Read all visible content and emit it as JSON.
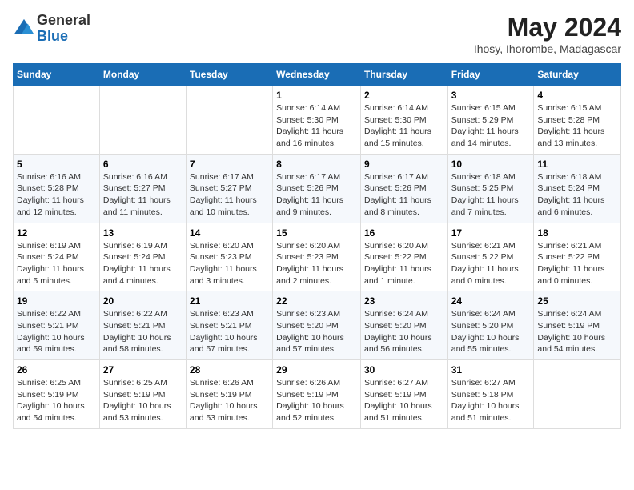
{
  "logo": {
    "general": "General",
    "blue": "Blue"
  },
  "title": "May 2024",
  "subtitle": "Ihosy, Ihorombe, Madagascar",
  "weekdays": [
    "Sunday",
    "Monday",
    "Tuesday",
    "Wednesday",
    "Thursday",
    "Friday",
    "Saturday"
  ],
  "weeks": [
    [
      {
        "day": "",
        "info": ""
      },
      {
        "day": "",
        "info": ""
      },
      {
        "day": "",
        "info": ""
      },
      {
        "day": "1",
        "info": "Sunrise: 6:14 AM\nSunset: 5:30 PM\nDaylight: 11 hours and 16 minutes."
      },
      {
        "day": "2",
        "info": "Sunrise: 6:14 AM\nSunset: 5:30 PM\nDaylight: 11 hours and 15 minutes."
      },
      {
        "day": "3",
        "info": "Sunrise: 6:15 AM\nSunset: 5:29 PM\nDaylight: 11 hours and 14 minutes."
      },
      {
        "day": "4",
        "info": "Sunrise: 6:15 AM\nSunset: 5:28 PM\nDaylight: 11 hours and 13 minutes."
      }
    ],
    [
      {
        "day": "5",
        "info": "Sunrise: 6:16 AM\nSunset: 5:28 PM\nDaylight: 11 hours and 12 minutes."
      },
      {
        "day": "6",
        "info": "Sunrise: 6:16 AM\nSunset: 5:27 PM\nDaylight: 11 hours and 11 minutes."
      },
      {
        "day": "7",
        "info": "Sunrise: 6:17 AM\nSunset: 5:27 PM\nDaylight: 11 hours and 10 minutes."
      },
      {
        "day": "8",
        "info": "Sunrise: 6:17 AM\nSunset: 5:26 PM\nDaylight: 11 hours and 9 minutes."
      },
      {
        "day": "9",
        "info": "Sunrise: 6:17 AM\nSunset: 5:26 PM\nDaylight: 11 hours and 8 minutes."
      },
      {
        "day": "10",
        "info": "Sunrise: 6:18 AM\nSunset: 5:25 PM\nDaylight: 11 hours and 7 minutes."
      },
      {
        "day": "11",
        "info": "Sunrise: 6:18 AM\nSunset: 5:24 PM\nDaylight: 11 hours and 6 minutes."
      }
    ],
    [
      {
        "day": "12",
        "info": "Sunrise: 6:19 AM\nSunset: 5:24 PM\nDaylight: 11 hours and 5 minutes."
      },
      {
        "day": "13",
        "info": "Sunrise: 6:19 AM\nSunset: 5:24 PM\nDaylight: 11 hours and 4 minutes."
      },
      {
        "day": "14",
        "info": "Sunrise: 6:20 AM\nSunset: 5:23 PM\nDaylight: 11 hours and 3 minutes."
      },
      {
        "day": "15",
        "info": "Sunrise: 6:20 AM\nSunset: 5:23 PM\nDaylight: 11 hours and 2 minutes."
      },
      {
        "day": "16",
        "info": "Sunrise: 6:20 AM\nSunset: 5:22 PM\nDaylight: 11 hours and 1 minute."
      },
      {
        "day": "17",
        "info": "Sunrise: 6:21 AM\nSunset: 5:22 PM\nDaylight: 11 hours and 0 minutes."
      },
      {
        "day": "18",
        "info": "Sunrise: 6:21 AM\nSunset: 5:22 PM\nDaylight: 11 hours and 0 minutes."
      }
    ],
    [
      {
        "day": "19",
        "info": "Sunrise: 6:22 AM\nSunset: 5:21 PM\nDaylight: 10 hours and 59 minutes."
      },
      {
        "day": "20",
        "info": "Sunrise: 6:22 AM\nSunset: 5:21 PM\nDaylight: 10 hours and 58 minutes."
      },
      {
        "day": "21",
        "info": "Sunrise: 6:23 AM\nSunset: 5:21 PM\nDaylight: 10 hours and 57 minutes."
      },
      {
        "day": "22",
        "info": "Sunrise: 6:23 AM\nSunset: 5:20 PM\nDaylight: 10 hours and 57 minutes."
      },
      {
        "day": "23",
        "info": "Sunrise: 6:24 AM\nSunset: 5:20 PM\nDaylight: 10 hours and 56 minutes."
      },
      {
        "day": "24",
        "info": "Sunrise: 6:24 AM\nSunset: 5:20 PM\nDaylight: 10 hours and 55 minutes."
      },
      {
        "day": "25",
        "info": "Sunrise: 6:24 AM\nSunset: 5:19 PM\nDaylight: 10 hours and 54 minutes."
      }
    ],
    [
      {
        "day": "26",
        "info": "Sunrise: 6:25 AM\nSunset: 5:19 PM\nDaylight: 10 hours and 54 minutes."
      },
      {
        "day": "27",
        "info": "Sunrise: 6:25 AM\nSunset: 5:19 PM\nDaylight: 10 hours and 53 minutes."
      },
      {
        "day": "28",
        "info": "Sunrise: 6:26 AM\nSunset: 5:19 PM\nDaylight: 10 hours and 53 minutes."
      },
      {
        "day": "29",
        "info": "Sunrise: 6:26 AM\nSunset: 5:19 PM\nDaylight: 10 hours and 52 minutes."
      },
      {
        "day": "30",
        "info": "Sunrise: 6:27 AM\nSunset: 5:19 PM\nDaylight: 10 hours and 51 minutes."
      },
      {
        "day": "31",
        "info": "Sunrise: 6:27 AM\nSunset: 5:18 PM\nDaylight: 10 hours and 51 minutes."
      },
      {
        "day": "",
        "info": ""
      }
    ]
  ]
}
